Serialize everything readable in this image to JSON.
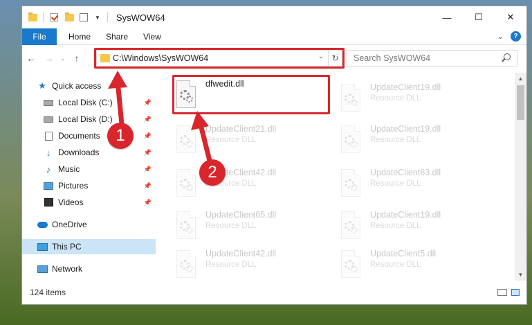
{
  "window": {
    "title": "SysWOW64",
    "minimize": "—",
    "maximize": "☐",
    "close": "✕"
  },
  "ribbon": {
    "tabs": [
      "File",
      "Home",
      "Share",
      "View"
    ]
  },
  "nav": {
    "back": "←",
    "forward": "→",
    "recent": "⌄",
    "up": "↑",
    "address": "C:\\Windows\\SysWOW64",
    "search_placeholder": "Search SysWOW64"
  },
  "sidebar": {
    "items": [
      {
        "label": "Quick access",
        "icon": "star-icon",
        "pinned": false
      },
      {
        "label": "Local Disk (C:)",
        "icon": "drive-icon",
        "pinned": true
      },
      {
        "label": "Local Disk (D:)",
        "icon": "drive-icon",
        "pinned": true
      },
      {
        "label": "Documents",
        "icon": "documents-icon",
        "pinned": true
      },
      {
        "label": "Downloads",
        "icon": "downloads-icon",
        "pinned": true
      },
      {
        "label": "Music",
        "icon": "music-icon",
        "pinned": true
      },
      {
        "label": "Pictures",
        "icon": "pictures-icon",
        "pinned": true
      },
      {
        "label": "Videos",
        "icon": "videos-icon",
        "pinned": true
      },
      {
        "label": "OneDrive",
        "icon": "onedrive-icon",
        "pinned": false
      },
      {
        "label": "This PC",
        "icon": "this-pc-icon",
        "pinned": false,
        "selected": true
      },
      {
        "label": "Network",
        "icon": "network-icon",
        "pinned": false
      }
    ]
  },
  "files": [
    {
      "name": "dfwedit.dll",
      "type": "",
      "highlighted": true
    },
    {
      "name": "UpdateClient19.dll",
      "type": "Resource DLL"
    },
    {
      "name": "UpdateClient21.dll",
      "type": "Resource DLL"
    },
    {
      "name": "UpdateClient19.dll",
      "type": "Resource DLL"
    },
    {
      "name": "UpdateClient42.dll",
      "type": "Resource DLL"
    },
    {
      "name": "UpdateClient63.dll",
      "type": "Resource DLL"
    },
    {
      "name": "UpdateClient65.dll",
      "type": "Resource DLL"
    },
    {
      "name": "UpdateClient19.dll",
      "type": "Resource DLL"
    },
    {
      "name": "UpdateClient42.dll",
      "type": "Resource DLL"
    },
    {
      "name": "UpdateClient5.dll",
      "type": "Resource DLL"
    }
  ],
  "status": {
    "item_count": "124 items"
  },
  "callouts": [
    "1",
    "2"
  ],
  "colors": {
    "accent": "#1979ca",
    "highlight": "#d9262c",
    "selected": "#cce4f7"
  }
}
